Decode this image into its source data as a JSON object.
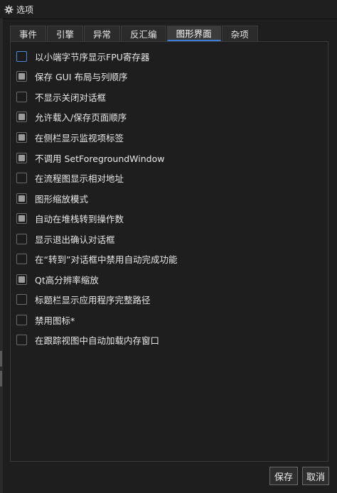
{
  "window": {
    "title": "选项",
    "icon": "gear-icon"
  },
  "tabs": [
    {
      "label": "事件",
      "active": false
    },
    {
      "label": "引擎",
      "active": false
    },
    {
      "label": "异常",
      "active": false
    },
    {
      "label": "反汇编",
      "active": false
    },
    {
      "label": "图形界面",
      "active": true
    },
    {
      "label": "杂项",
      "active": false
    }
  ],
  "options": [
    {
      "label": "以小端字节序显示FPU寄存器",
      "checked": false,
      "focused": true
    },
    {
      "label": "保存 GUI 布局与列顺序",
      "checked": true,
      "focused": false
    },
    {
      "label": "不显示关闭对话框",
      "checked": false,
      "focused": false
    },
    {
      "label": "允许载入/保存页面顺序",
      "checked": true,
      "focused": false
    },
    {
      "label": "在侧栏显示监视项标签",
      "checked": true,
      "focused": false
    },
    {
      "label": "不调用 SetForegroundWindow",
      "checked": true,
      "focused": false
    },
    {
      "label": "在流程图显示相对地址",
      "checked": false,
      "focused": false
    },
    {
      "label": "图形缩放模式",
      "checked": true,
      "focused": false
    },
    {
      "label": "自动在堆栈转到操作数",
      "checked": true,
      "focused": false
    },
    {
      "label": "显示退出确认对话框",
      "checked": false,
      "focused": false
    },
    {
      "label": "在“转到”对话框中禁用自动完成功能",
      "checked": false,
      "focused": false
    },
    {
      "label": "Qt高分辨率缩放",
      "checked": true,
      "focused": false
    },
    {
      "label": "标题栏显示应用程序完整路径",
      "checked": false,
      "focused": false
    },
    {
      "label": "禁用图标*",
      "checked": false,
      "focused": false
    },
    {
      "label": "在跟踪视图中自动加载内存窗口",
      "checked": false,
      "focused": false
    }
  ],
  "buttons": {
    "save_label": "保存",
    "cancel_label": "取消"
  },
  "colors": {
    "background": "#1e1e1e",
    "accent": "#3d7fd6",
    "check_fill": "#9c9c9c"
  }
}
